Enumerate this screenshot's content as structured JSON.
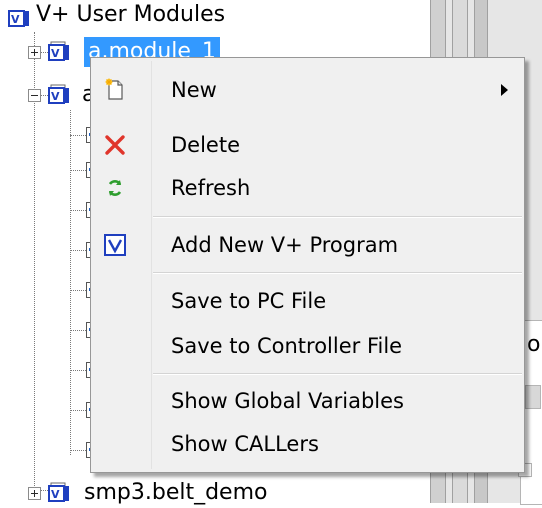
{
  "tree": {
    "root_label": "V+ User Modules",
    "items": [
      {
        "label": "a.module_1",
        "expander": "plus",
        "selected": true
      },
      {
        "label": "a",
        "expander": "minus",
        "selected": false
      },
      {
        "label": "smp3.belt_demo",
        "expander": "plus",
        "selected": false
      }
    ]
  },
  "right_pane": {
    "partial_text_1": "o",
    "partial_text_2": "-"
  },
  "context_menu": {
    "items": [
      {
        "label": "New",
        "icon": "new-document-icon",
        "has_submenu": true
      },
      {
        "label": "Delete",
        "icon": "delete-x-icon",
        "has_submenu": false
      },
      {
        "label": "Refresh",
        "icon": "refresh-arrows-icon",
        "has_submenu": false
      },
      {
        "label": "Add New V+ Program",
        "icon": "vplus-program-icon",
        "has_submenu": false
      },
      {
        "label": "Save to PC File",
        "icon": "",
        "has_submenu": false
      },
      {
        "label": "Save to Controller File",
        "icon": "",
        "has_submenu": false
      },
      {
        "label": "Show Global Variables",
        "icon": "",
        "has_submenu": false
      },
      {
        "label": "Show CALLers",
        "icon": "",
        "has_submenu": false
      }
    ]
  },
  "colors": {
    "selection": "#3399ff",
    "menu_background": "#f0f0f0",
    "delete_icon": "#e0352b",
    "refresh_icon": "#2f9e2f",
    "vplus_icon": "#1f3fbf"
  }
}
